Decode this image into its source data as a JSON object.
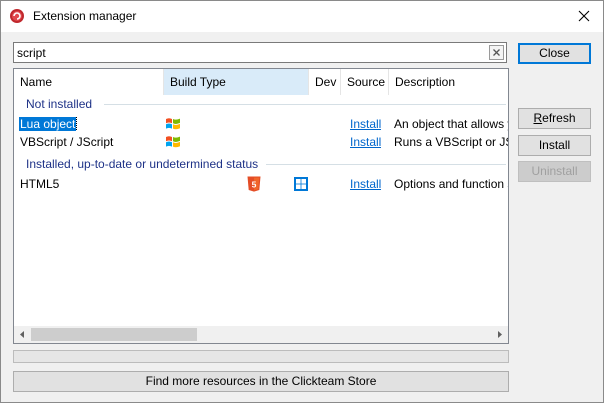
{
  "window": {
    "title": "Extension manager"
  },
  "search": {
    "value": "script",
    "clear_label": "×"
  },
  "columns": [
    "Name",
    "Build Type",
    "Dev",
    "Source",
    "Description"
  ],
  "groups": [
    {
      "label": "Not installed",
      "rows": [
        {
          "name": "Lua object",
          "build": "windows-flag-icon",
          "dev": "",
          "source": "Install",
          "description": "An object that allows yo"
        },
        {
          "name": "VBScript / JScript",
          "build": "windows-flag-icon",
          "dev": "",
          "source": "Install",
          "description": "Runs a VBScript or JScri"
        }
      ]
    },
    {
      "label": "Installed, up-to-date or undetermined status",
      "rows": [
        {
          "name": "HTML5",
          "build": "html5-icon",
          "dev": "windows-tiles-icon",
          "source": "Install",
          "description": "Options and function sp"
        }
      ]
    }
  ],
  "buttons": {
    "close": "Close",
    "refresh_first": "R",
    "refresh_rest": "efresh",
    "install": "Install",
    "uninstall": "Uninstall"
  },
  "store_button": "Find more resources in the Clickteam Store",
  "colors": {
    "accent": "#0078d7",
    "group": "#1e3287",
    "link": "#0066cc",
    "html5": "#e44d26"
  }
}
